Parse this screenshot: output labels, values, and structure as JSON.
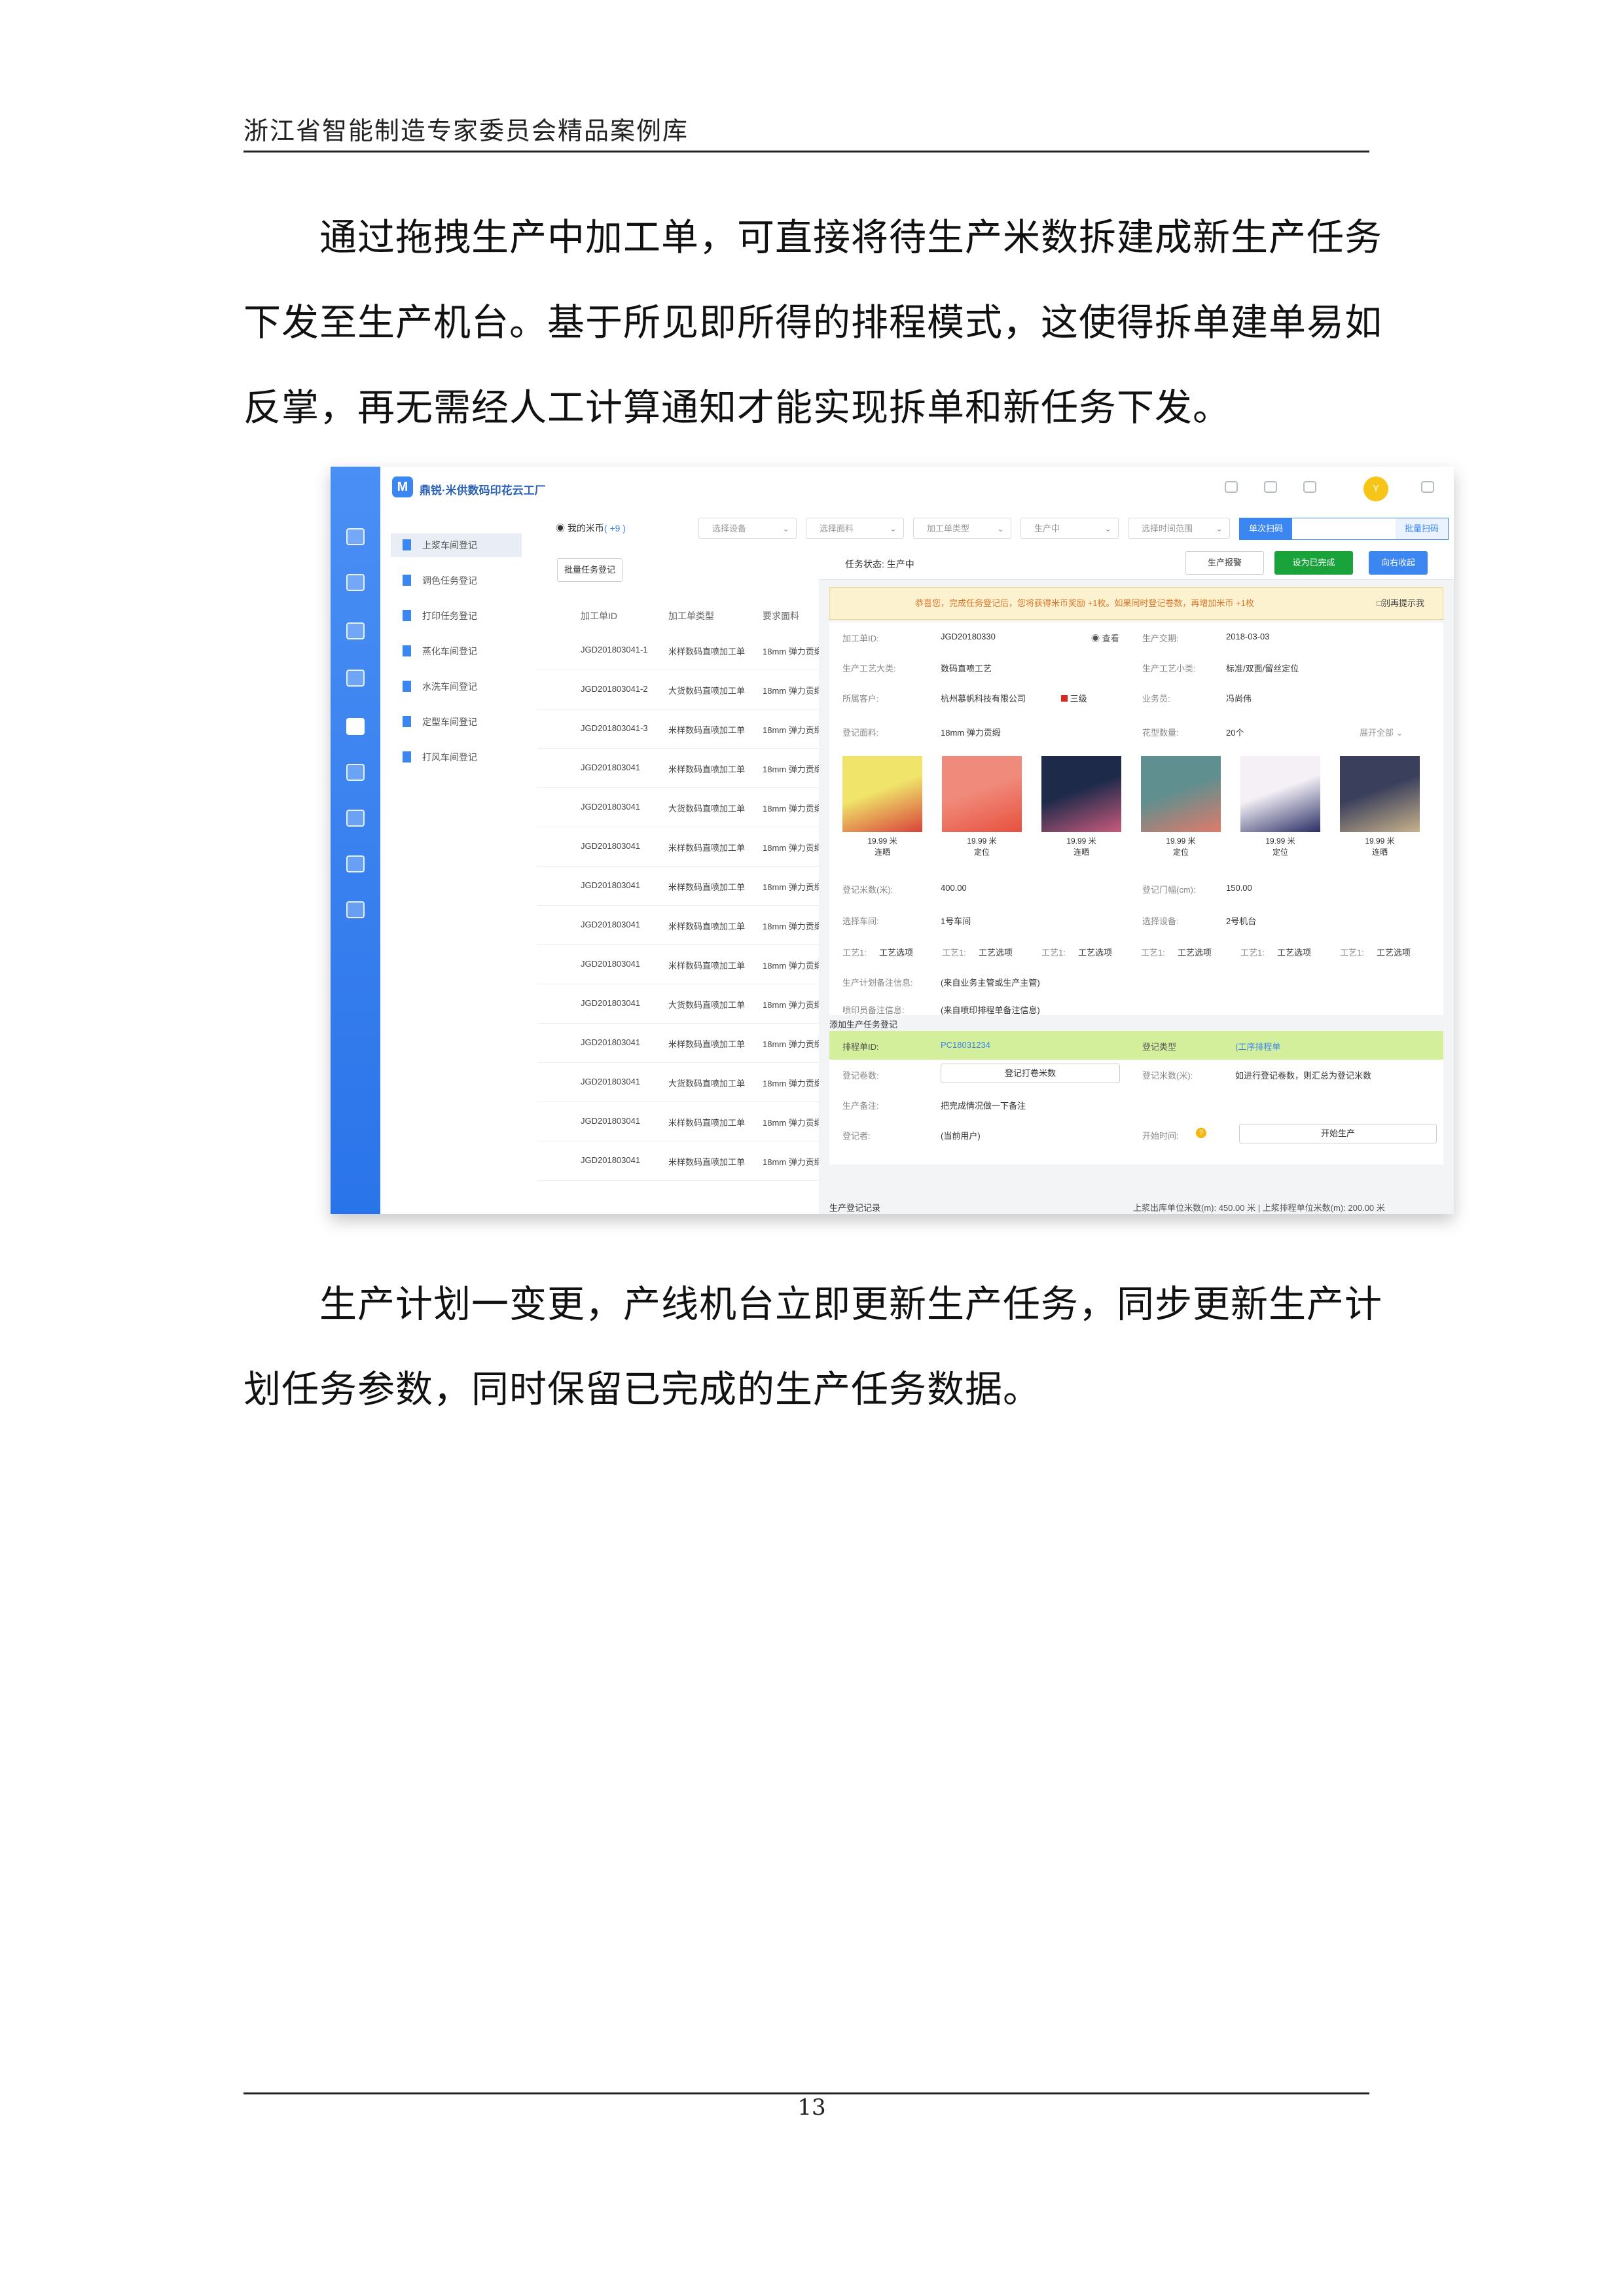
{
  "header": {
    "title": "浙江省智能制造专家委员会精品案例库"
  },
  "paragraph1": {
    "lines": [
      "通过拖拽生产中加工单，可直接将待生产米数拆建成新生产任务",
      "下发至生产机台。基于所见即所得的排程模式，这使得拆单建单易如",
      "反掌，再无需经人工计算通知才能实现拆单和新任务下发。"
    ]
  },
  "paragraph2": {
    "lines": [
      "生产计划一变更，产线机台立即更新生产任务，同步更新生产计",
      "划任务参数，同时保留已完成的生产任务数据。"
    ]
  },
  "page_number": "13",
  "screenshot": {
    "brand": "鼎锐·米供数码印花云工厂",
    "avatar": "Y",
    "menu": [
      "上浆车间登记",
      "调色任务登记",
      "打印任务登记",
      "蒸化车间登记",
      "水洗车间登记",
      "定型车间登记",
      "打风车间登记"
    ],
    "coin_label": "我的米币",
    "coin_value": "( +9 )",
    "filters": [
      "选择设备",
      "选择面料",
      "加工单类型",
      "生产中",
      "选择时间范围"
    ],
    "scan_single": "单次扫码",
    "scan_batch": "批量扫码",
    "batch_task_button": "批量任务登记",
    "table_headers": [
      "加工单ID",
      "加工单类型",
      "要求面料"
    ],
    "table_rows": [
      {
        "id": "JGD201803041-1",
        "type": "米样数码直喷加工单",
        "fabric": "18mm 弹力贡缎"
      },
      {
        "id": "JGD201803041-2",
        "type": "大货数码直喷加工单",
        "fabric": "18mm 弹力贡缎"
      },
      {
        "id": "JGD201803041-3",
        "type": "米样数码直喷加工单",
        "fabric": "18mm 弹力贡缎"
      },
      {
        "id": "JGD201803041",
        "type": "米样数码直喷加工单",
        "fabric": "18mm 弹力贡缎"
      },
      {
        "id": "JGD201803041",
        "type": "大货数码直喷加工单",
        "fabric": "18mm 弹力贡缎"
      },
      {
        "id": "JGD201803041",
        "type": "米样数码直喷加工单",
        "fabric": "18mm 弹力贡缎"
      },
      {
        "id": "JGD201803041",
        "type": "米样数码直喷加工单",
        "fabric": "18mm 弹力贡缎"
      },
      {
        "id": "JGD201803041",
        "type": "米样数码直喷加工单",
        "fabric": "18mm 弹力贡缎"
      },
      {
        "id": "JGD201803041",
        "type": "米样数码直喷加工单",
        "fabric": "18mm 弹力贡缎"
      },
      {
        "id": "JGD201803041",
        "type": "大货数码直喷加工单",
        "fabric": "18mm 弹力贡缎"
      },
      {
        "id": "JGD201803041",
        "type": "米样数码直喷加工单",
        "fabric": "18mm 弹力贡缎"
      },
      {
        "id": "JGD201803041",
        "type": "大货数码直喷加工单",
        "fabric": "18mm 弹力贡缎"
      },
      {
        "id": "JGD201803041",
        "type": "米样数码直喷加工单",
        "fabric": "18mm 弹力贡缎"
      },
      {
        "id": "JGD201803041",
        "type": "米样数码直喷加工单",
        "fabric": "18mm 弹力贡缎"
      }
    ],
    "task_status_label": "任务状态:",
    "task_status_value": "生产中",
    "btn_report": "生产报警",
    "btn_done": "设为已完成",
    "btn_collapse": "向右收起",
    "alert_text": "恭喜您，完成任务登记后，您将获得米币奖励 +1枚。如果同时登记卷数，再增加米币 +1枚",
    "alert_checkbox": "□别再提示我",
    "detail": {
      "order_id_label": "加工单ID:",
      "order_id": "JGD20180330",
      "view": "查看",
      "delivery_label": "生产交期:",
      "delivery": "2018-03-03",
      "process_label": "生产工艺大类:",
      "process": "数码直喷工艺",
      "subprocess_label": "生产工艺小类:",
      "subprocess": "标准/双面/留丝定位",
      "customer_label": "所属客户:",
      "customer": "杭州慕帆科技有限公司",
      "level": "三级",
      "sales_label": "业务员:",
      "sales": "冯尚伟",
      "fabric_label": "登记面料:",
      "fabric": "18mm 弹力贡缎",
      "pattern_label": "花型数量:",
      "pattern_count": "20个",
      "expand": "展开全部",
      "swatches": [
        {
          "size": "19.99 米",
          "mode": "连晒",
          "color1": "#f0e56a",
          "color2": "#d8433a"
        },
        {
          "size": "19.99 米",
          "mode": "定位",
          "color1": "#f08a7a",
          "color2": "#e8503e"
        },
        {
          "size": "19.99 米",
          "mode": "连晒",
          "color1": "#1d2a4a",
          "color2": "#c95a7c"
        },
        {
          "size": "19.99 米",
          "mode": "定位",
          "color1": "#5f8f8f",
          "color2": "#e07a6a"
        },
        {
          "size": "19.99 米",
          "mode": "定位",
          "color1": "#f4f0f6",
          "color2": "#2a2e66"
        },
        {
          "size": "19.99 米",
          "mode": "连晒",
          "color1": "#3a3f5c",
          "color2": "#c8b28a"
        }
      ],
      "meters_label": "登记米数(米):",
      "meters": "400.00",
      "width_label": "登记门幅(cm):",
      "width": "150.00",
      "workshop_label": "选择车间:",
      "workshop": "1号车间",
      "device_label": "选择设备:",
      "device": "2号机台",
      "craft_label": "工艺1:",
      "craft_option": "工艺选项",
      "plan_note_label": "生产计划备注信息:",
      "plan_note": "(来自业务主管或生产主管)",
      "color_note_label": "喷印员备注信息:",
      "color_note": "(来自喷印排程单备注信息)"
    },
    "add_task_title": "添加生产任务登记",
    "schedule_label": "排程单ID:",
    "schedule_id": "PC18031234",
    "reg_type_label": "登记类型",
    "reg_type": "(工序排程单",
    "reg_param_label": "登记卷数:",
    "reg_param_btn": "登记打卷米数",
    "reg_meters_label": "登记米数(米):",
    "reg_meters_hint": "如进行登记卷数，则汇总为登记米数",
    "prod_note_label": "生产备注:",
    "prod_note": "把完成情况做一下备注",
    "registrar_label": "登记者:",
    "registrar": "(当前用户)",
    "start_time_label": "开始时间:",
    "start_btn": "开始生产",
    "record_label": "生产登记记录",
    "record_summary": "上浆出库单位米数(m): 450.00 米 | 上浆排程单位米数(m): 200.00 米"
  }
}
